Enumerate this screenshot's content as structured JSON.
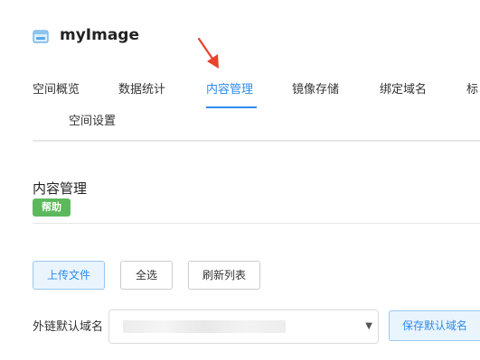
{
  "header": {
    "title": "myImage",
    "icon": "bucket-icon"
  },
  "tabs": [
    {
      "label": "空间概览",
      "active": false
    },
    {
      "label": "数据统计",
      "active": false
    },
    {
      "label": "内容管理",
      "active": true
    },
    {
      "label": "镜像存储",
      "active": false
    },
    {
      "label": "绑定域名",
      "active": false
    },
    {
      "label": "标",
      "active": false
    },
    {
      "label": "空间设置",
      "active": false
    }
  ],
  "section": {
    "title": "内容管理",
    "help_label": "帮助"
  },
  "toolbar": {
    "upload_label": "上传文件",
    "select_all_label": "全选",
    "refresh_label": "刷新列表"
  },
  "domain": {
    "label": "外链默认域名",
    "save_label": "保存默认域名"
  },
  "colors": {
    "accent": "#2d8cf0",
    "help_badge": "#5cb85c",
    "arrow": "#e8412c"
  }
}
